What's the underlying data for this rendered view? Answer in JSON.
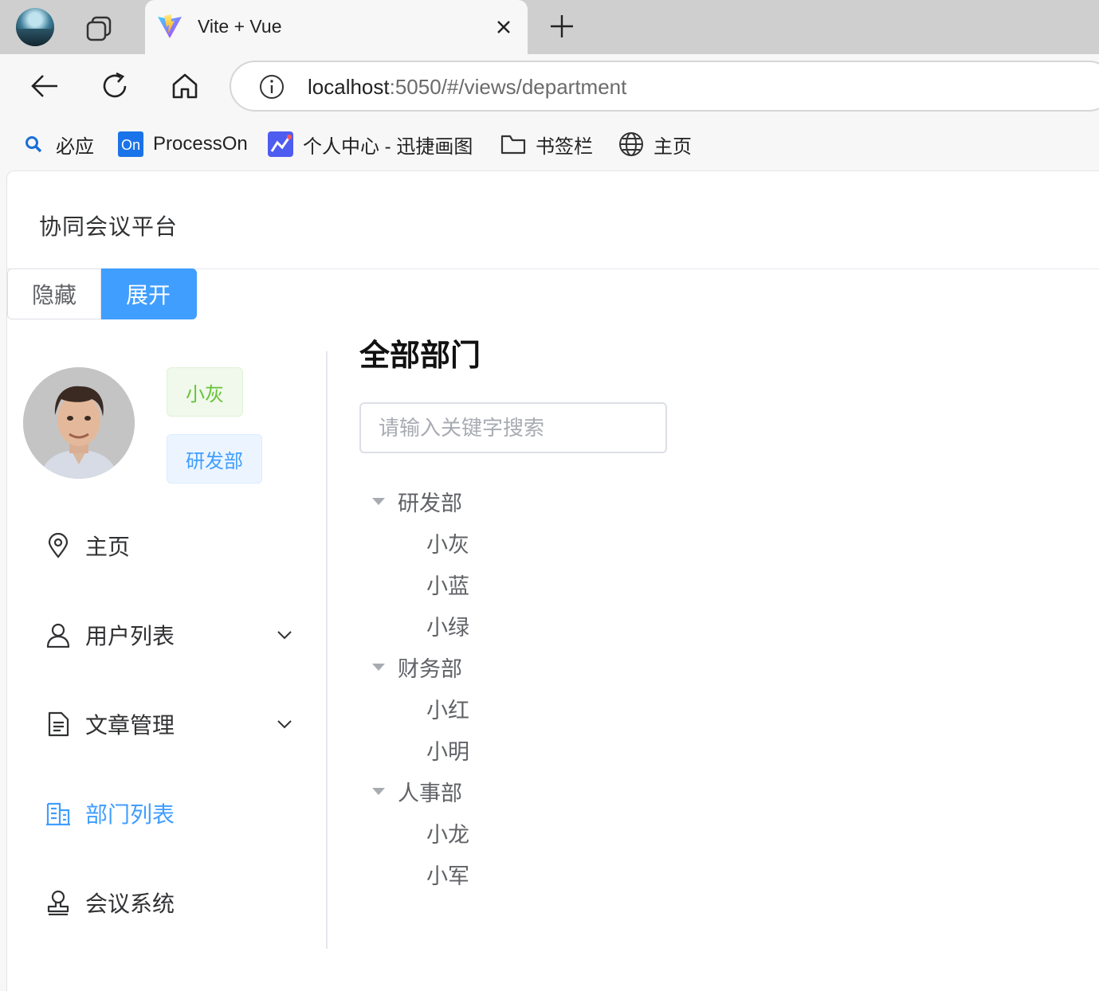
{
  "browser": {
    "tab": {
      "title": "Vite + Vue"
    },
    "address": {
      "host": "localhost",
      "path": ":5050/#/views/department"
    },
    "bookmarks": [
      {
        "label": "必应",
        "icon": "search-icon"
      },
      {
        "label": "ProcessOn",
        "icon": "processon-icon"
      },
      {
        "label": "个人中心 - 迅捷画图",
        "icon": "chart-app-icon"
      },
      {
        "label": "书签栏",
        "icon": "folder-icon"
      },
      {
        "label": "主页",
        "icon": "globe-icon"
      }
    ]
  },
  "app": {
    "title": "协同会议平台",
    "buttons": {
      "hide": "隐藏",
      "expand": "展开"
    },
    "user": {
      "name": "小灰",
      "department": "研发部"
    },
    "menu": [
      {
        "label": "主页",
        "icon": "location-icon",
        "has_submenu": false,
        "active": false
      },
      {
        "label": "用户列表",
        "icon": "user-icon",
        "has_submenu": true,
        "active": false
      },
      {
        "label": "文章管理",
        "icon": "document-icon",
        "has_submenu": true,
        "active": false
      },
      {
        "label": "部门列表",
        "icon": "office-building-icon",
        "has_submenu": false,
        "active": true
      },
      {
        "label": "会议系统",
        "icon": "stamp-icon",
        "has_submenu": false,
        "active": false
      }
    ],
    "main": {
      "title": "全部部门",
      "search_placeholder": "请输入关键字搜索",
      "tree": [
        {
          "label": "研发部",
          "children": [
            "小灰",
            "小蓝",
            "小绿"
          ]
        },
        {
          "label": "财务部",
          "children": [
            "小红",
            "小明"
          ]
        },
        {
          "label": "人事部",
          "children": [
            "小龙",
            "小军"
          ]
        }
      ]
    }
  },
  "colors": {
    "accent": "#409eff",
    "success": "#67c23a",
    "text": "#303133",
    "muted": "#606266"
  }
}
